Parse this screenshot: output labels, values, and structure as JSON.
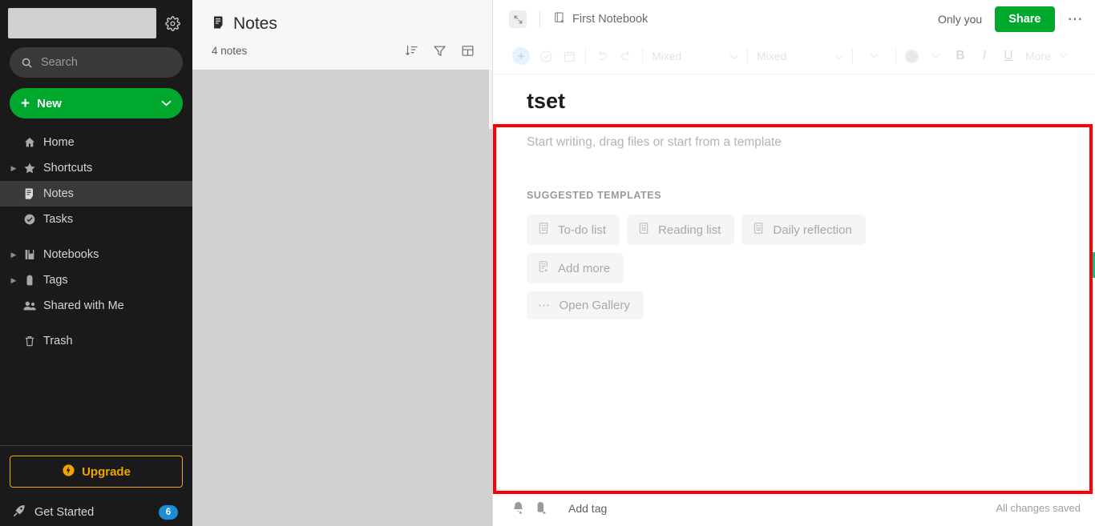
{
  "sidebar": {
    "account_placeholder": "",
    "gear_icon": "gear-icon",
    "search": {
      "placeholder": "Search",
      "icon": "search-icon"
    },
    "new_button": {
      "label": "New",
      "plus": "+",
      "caret": "⌄",
      "color": "#00a82d"
    },
    "nav_items": [
      {
        "label": "Home",
        "icon": "home-icon",
        "expandable": false,
        "active": false
      },
      {
        "label": "Shortcuts",
        "icon": "star-icon",
        "expandable": true,
        "active": false
      },
      {
        "label": "Notes",
        "icon": "notes-icon",
        "expandable": false,
        "active": true
      },
      {
        "label": "Tasks",
        "icon": "task-check-icon",
        "expandable": false,
        "active": false
      }
    ],
    "nav_items_group2": [
      {
        "label": "Notebooks",
        "icon": "notebook-icon",
        "expandable": true,
        "active": false
      },
      {
        "label": "Tags",
        "icon": "tag-icon",
        "expandable": true,
        "active": false
      },
      {
        "label": "Shared with Me",
        "icon": "people-icon",
        "expandable": false,
        "active": false
      }
    ],
    "nav_items_group3": [
      {
        "label": "Trash",
        "icon": "trash-icon",
        "expandable": false,
        "active": false
      }
    ],
    "upgrade": {
      "label": "Upgrade",
      "icon": "upgrade-bolt-icon",
      "color": "#f0a500"
    },
    "get_started": {
      "label": "Get Started",
      "icon": "rocket-icon",
      "badge": "6",
      "badge_color": "#1b8cd8"
    }
  },
  "notelist": {
    "title": "Notes",
    "title_icon": "notes-icon",
    "count": "4 notes",
    "tools": [
      {
        "name": "sort-icon",
        "label": "Sort"
      },
      {
        "name": "filter-icon",
        "label": "Filter"
      },
      {
        "name": "view-options-icon",
        "label": "View options"
      }
    ]
  },
  "editor": {
    "header": {
      "expand_icon": "expand-collapse-icon",
      "notebook_icon": "notebook-star-icon",
      "notebook_name": "First Notebook",
      "only_you": "Only you",
      "share_label": "Share",
      "share_color": "#00a82d",
      "more_icon": "more-horizontal-icon"
    },
    "toolbar": {
      "plus": "+",
      "items": [
        {
          "name": "task-checkbox-icon"
        },
        {
          "name": "calendar-icon"
        },
        {
          "name": "undo-icon"
        },
        {
          "name": "redo-icon"
        }
      ],
      "font_family": "Mixed",
      "font_size": "Mixed",
      "caret": "⌄",
      "bold": "B",
      "italic": "I",
      "underline": "U",
      "more": "More"
    },
    "note_title": "tset",
    "placeholder": "Start writing, drag files or start from a template",
    "templates_heading": "SUGGESTED TEMPLATES",
    "template_rows": [
      [
        {
          "label": "To-do list",
          "icon": "template-doc-icon"
        },
        {
          "label": "Reading list",
          "icon": "template-doc-icon"
        },
        {
          "label": "Daily reflection",
          "icon": "template-doc-icon"
        }
      ],
      [
        {
          "label": "Add more",
          "icon": "template-add-icon"
        }
      ],
      [
        {
          "label": "Open Gallery",
          "icon": "ellipsis-icon"
        }
      ]
    ],
    "footer": {
      "reminder_icon": "add-reminder-icon",
      "tag_icon": "add-tag-icon",
      "add_tag": "Add tag",
      "saved_status": "All changes saved"
    }
  },
  "overlay": {
    "highlight_color": "#ff0000",
    "side_tab_color": "#00c08b"
  }
}
